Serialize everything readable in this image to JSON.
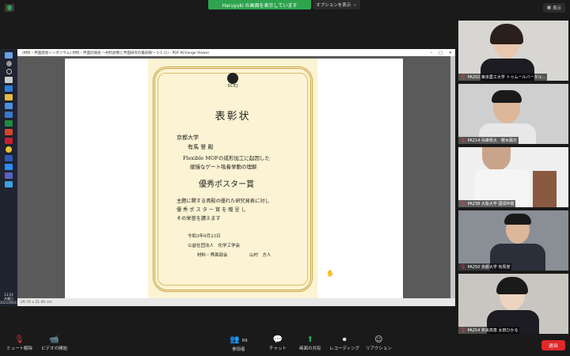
{
  "share_banner": {
    "text": "Haruyuki の画面を表示しています"
  },
  "share_options": {
    "label": "オプションを表示"
  },
  "view_button": {
    "label": "表示"
  },
  "app_window": {
    "title": "(材料・界面部会シンポジウム) 材料・界面討論会 ～材料創製と界面研究の最前線～ 1-1 (1) - PDF-XChange Viewer",
    "status": "29.70 x 21.00 cm"
  },
  "taskbar": {
    "clock_time": "13:24",
    "clock_day": "木曜日",
    "clock_date": "2021/09/23"
  },
  "certificate": {
    "logo_text": "SCEJ",
    "title": "表彰状",
    "university": "京都大学",
    "recipient": "有馬 誉 殿",
    "topic_line1": "Flexible MOFの成形加工に起因した",
    "topic_line2": "緩慢なゲート吸着挙動の理解",
    "award": "優秀ポスター賞",
    "body_line1": "主題に関する貴殿の優れた研究発表に対し",
    "body_line2": "優 秀 ポ ス タ ー 賞 を 贈 呈 し",
    "body_line3": "その栄誉を讃えます",
    "date": "令和3年9月23日",
    "org": "公益社団法人　化学工学会",
    "division": "材料・界面部会",
    "chair": "山村　方人"
  },
  "participants": [
    {
      "label": "PA202 東京農工大学 トゥムールバータル..."
    },
    {
      "label": "PA214 兵庫県大　櫻木陽次"
    },
    {
      "label": "PA238 大阪大学 國領伴樹"
    },
    {
      "label": "PA250 京都大学 有馬誉"
    },
    {
      "label": "PA254 奈良高専 太田ひかる"
    }
  ],
  "toolbar": {
    "mute": "ミュート解除",
    "video": "ビデオの開始",
    "participants": "参加者",
    "participants_count": "69",
    "chat": "チャット",
    "share": "画面の共有",
    "recording": "レコーディング",
    "reaction": "リアクション",
    "leave": "退出"
  },
  "colors": {
    "share_green": "#2ea44f",
    "leave_red": "#e02828",
    "cert_gold": "#c9a545"
  }
}
